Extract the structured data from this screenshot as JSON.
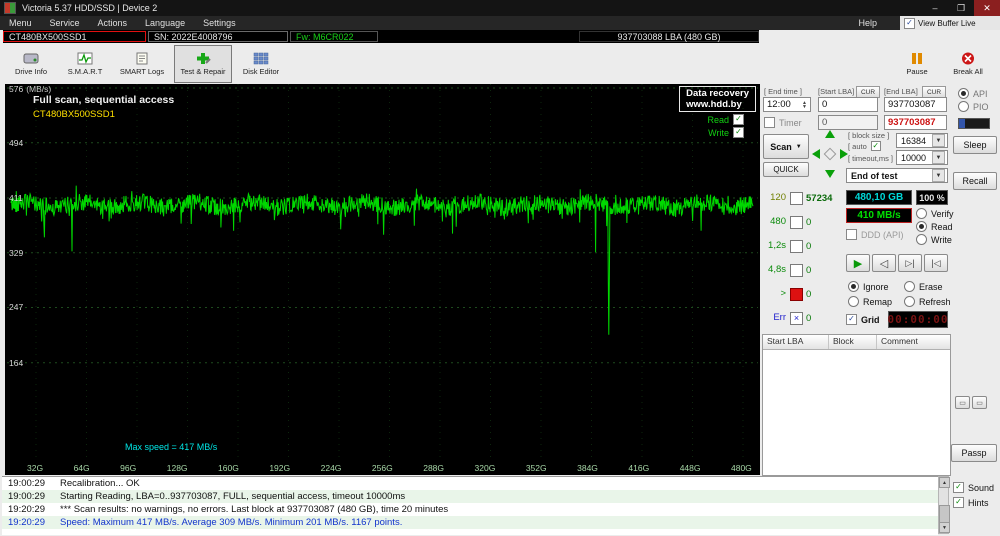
{
  "colors": {
    "graph_line": "#00d800",
    "grid_line": "#1d4a1d",
    "vgrid_line": "#0d260d",
    "max_note": "#00e5e5",
    "model_yellow": "#ffe000",
    "speed_text": "#00e000",
    "capacity_text": "#00d8d8"
  },
  "titlebar": {
    "title": "Victoria 5.37 HDD/SSD | Device 2",
    "minimize": "–",
    "maximize": "❐",
    "close": "✕"
  },
  "menubar": {
    "items": [
      "Menu",
      "Service",
      "Actions",
      "Language",
      "Settings"
    ],
    "help": "Help",
    "view_buffer": "View Buffer Live"
  },
  "device_bar": {
    "model": "CT480BX500SSD1",
    "serial": "SN: 2022E4008796",
    "firmware": "Fw: M6CR022",
    "capacity": "937703088 LBA (480 GB)"
  },
  "toolbar": {
    "buttons": [
      "Drive Info",
      "S.M.A.R.T",
      "SMART Logs",
      "Test & Repair",
      "Disk Editor"
    ],
    "pause": "Pause",
    "break_all": "Break All"
  },
  "graph": {
    "title": "Full scan, sequential access",
    "model": "CT480BX500SSD1",
    "watermark_line1": "Data recovery",
    "watermark_line2": "www.hdd.by",
    "legend_read": "Read",
    "legend_write": "Write",
    "max_speed_note": "Max speed = 417 MB/s",
    "y_unit": "(MB/s)",
    "y_labels": [
      576,
      494,
      411,
      329,
      247,
      164
    ],
    "x_labels": [
      "32G",
      "64G",
      "96G",
      "128G",
      "160G",
      "192G",
      "224G",
      "256G",
      "288G",
      "320G",
      "352G",
      "384G",
      "416G",
      "448G",
      "480G"
    ],
    "baseline": 401,
    "noise": 13,
    "seed": 42,
    "dips": [
      {
        "pos": 0.045,
        "value": 352
      },
      {
        "pos": 0.082,
        "value": 331
      },
      {
        "pos": 0.3,
        "value": 362
      },
      {
        "pos": 0.502,
        "value": 356
      },
      {
        "pos": 0.6,
        "value": 368
      },
      {
        "pos": 0.788,
        "value": 330
      },
      {
        "pos": 0.806,
        "value": 206
      },
      {
        "pos": 0.93,
        "value": 362
      }
    ]
  },
  "controls": {
    "end_time_label": "[ End time ]",
    "end_time": "12:00",
    "start_lba_label": "[Start LBA]",
    "cur": "CUR",
    "start_lba": "0",
    "end_lba_label": "[End LBA]",
    "end_lba": "937703087",
    "end_lba_red": "937703087",
    "timer_label": "Timer",
    "timer_value": "0",
    "scan": "Scan",
    "quick": "QUICK",
    "block_size_label": "[ block size ]",
    "auto_label": "[ auto",
    "block_size": "16384",
    "timeout_label": "[ timeout,ms ]",
    "timeout": "10000",
    "end_of_test": "End of test"
  },
  "counters": [
    {
      "label": "120",
      "value": "57234"
    },
    {
      "label": "480",
      "value": "0"
    },
    {
      "label": "1,2s",
      "value": "0"
    },
    {
      "label": "4,8s",
      "value": "0"
    },
    {
      "label": ">",
      "value": "0"
    },
    {
      "label": "Err",
      "value": "0"
    }
  ],
  "status": {
    "capacity": "480,10 GB",
    "percent": "100  %",
    "speed": "410 MB/s",
    "timer_display": "00:00:00",
    "ddd": "DDD (API)",
    "grid": "Grid"
  },
  "mode_radios": {
    "verify": "Verify",
    "read": "Read",
    "write": "Write"
  },
  "action_radios": {
    "ignore": "Ignore",
    "erase": "Erase",
    "remap": "Remap",
    "refresh": "Refresh"
  },
  "table": {
    "headers": [
      "Start LBA",
      "Block",
      "Comment"
    ]
  },
  "side": {
    "api": "API",
    "pio": "PIO",
    "sleep": "Sleep",
    "recall": "Recall",
    "passp": "Passp",
    "sound": "Sound",
    "hints": "Hints"
  },
  "log": {
    "rows": [
      {
        "time": "19:00:29",
        "text": "Recalibration... OK"
      },
      {
        "time": "19:00:29",
        "text": "Starting Reading, LBA=0..937703087, FULL, sequential access, timeout 10000ms"
      },
      {
        "time": "19:20:29",
        "text": "*** Scan results: no warnings, no errors. Last block at 937703087 (480 GB), time 20 minutes"
      },
      {
        "time": "19:20:29",
        "text": "Speed: Maximum 417 MB/s. Average 309 MB/s. Minimum 201 MB/s. 1167 points."
      }
    ]
  }
}
